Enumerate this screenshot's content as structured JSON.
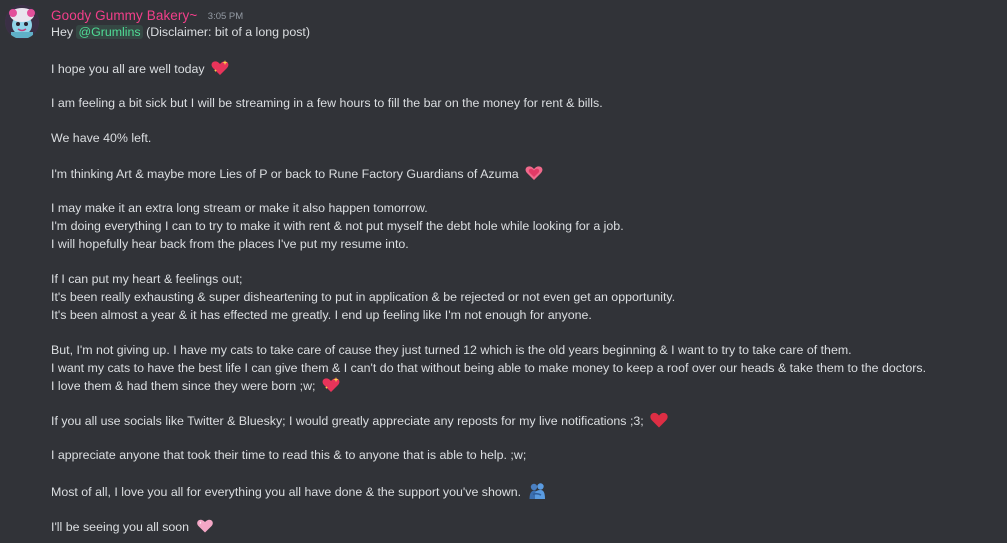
{
  "message": {
    "username": "Goody Gummy Bakery~",
    "timestamp": "3:05 PM",
    "greeting_prefix": "Hey ",
    "mention": "@Grumlins",
    "greeting_suffix": " (Disclaimer: bit of a long post)",
    "lines": {
      "l1": "I hope you all are well today",
      "l2": "I am feeling a bit sick but I will be streaming in a few hours to fill the bar on the money for rent & bills.",
      "l3": "We have 40%  left.",
      "l4": "I'm thinking Art & maybe more Lies of P or back to Rune Factory Guardians of Azuma",
      "l5": "I may make it an extra long stream or make it also happen tomorrow.",
      "l6": "I'm doing everything I can to try to make it with rent & not put myself the debt hole while looking for a job.",
      "l7": "I will hopefully hear back from the places I've put my resume into.",
      "l8": "If I can put my heart & feelings out;",
      "l9": "It's been really exhausting & super disheartening to put in application & be rejected or not even get an opportunity.",
      "l10": "It's been almost a year & it has effected me greatly. I end up feeling like I'm not enough for anyone.",
      "l11": "But, I'm not giving up. I have my cats to take care of cause they just turned 12 which is the old years beginning & I want to try to take care of them.",
      "l12": "I want my cats to have the best life I can give them & I can't do that without being able to make money to keep a roof over our heads & take them to the doctors.",
      "l13": "I love them & had them since they were born ;w;",
      "l14": "If you all use socials like Twitter & Bluesky; I would greatly appreciate any reposts for my live notifications ;3;",
      "l15": "I appreciate anyone that took their time to read this & to anyone that is able to help. ;w;",
      "l16": "Most of all, I love you all for everything you all have done & the support you've shown.",
      "l17": "I'll be seeing you all soon"
    },
    "emojis": {
      "e1": "sparkling-heart-icon",
      "e4": "heart-icon",
      "e13": "sparkling-heart-icon",
      "e14": "red-heart-icon",
      "e16": "people-hugging-icon",
      "e17": "pink-heart-icon"
    }
  },
  "colors": {
    "background": "#313338",
    "username": "#f23f8a",
    "text": "#dbdee1",
    "timestamp": "#949ba4",
    "mention": "#4fdc95"
  }
}
